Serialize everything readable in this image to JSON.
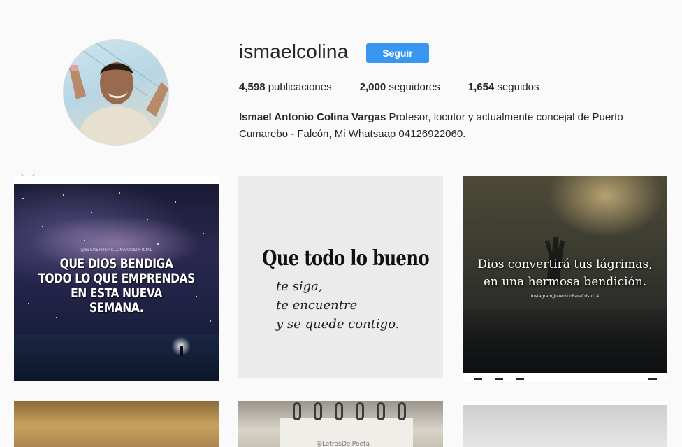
{
  "profile": {
    "username": "ismaelcolina",
    "follow_label": "Seguir",
    "stats": {
      "posts_count": "4,598",
      "posts_label": "publicaciones",
      "followers_count": "2,000",
      "followers_label": "seguidores",
      "following_count": "1,654",
      "following_label": "seguidos"
    },
    "bio_name": "Ismael Antonio Colina Vargas",
    "bio_text": " Profesor, locutor y actualmente concejal de Puerto Cumarebo - Falcón, Mi Whatsaap 04126922060."
  },
  "posts": [
    {
      "watermark": "@SECRETOSMILLONARIOSOFICIAL",
      "text": "QUE DIOS BENDIGA\nTODO LO QUE EMPRENDAS\nEN ESTA NUEVA\nSEMANA."
    },
    {
      "main": "Que todo lo bueno",
      "sub": "te siga,\nte encuentre\ny se quede contigo."
    },
    {
      "text": "Dios convertirá tus lágrimas,\nen una hermosa bendición.",
      "tag": "Instagram/JuventudParaCristo14"
    },
    {},
    {
      "handle": "@LetrasDelPoeta"
    },
    {}
  ],
  "colors": {
    "accent": "#3897f0",
    "background": "#fafafa",
    "text": "#262626"
  }
}
